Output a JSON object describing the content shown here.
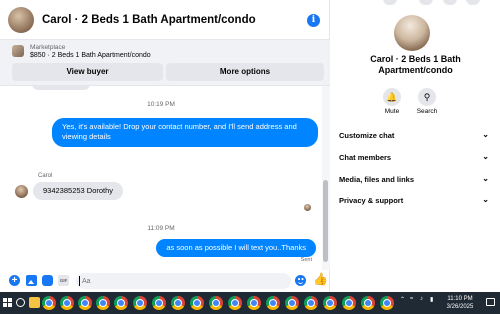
{
  "header": {
    "title": "Carol · 2 Beds 1 Bath Apartment/condo"
  },
  "marketplace": {
    "label": "Marketplace",
    "listing": "$850 · 2 Beds 1 Bath Apartment/condo",
    "view_buyer": "View buyer",
    "more_options": "More options"
  },
  "messages": {
    "time_1": "10:19 PM",
    "reply_1_line1": "Yes, it's available! Drop your contact number, and I'll send address and",
    "reply_1_line2": "viewing details",
    "sender": "Carol",
    "incoming_1": "9342385253 Dorothy",
    "time_2": "11:09 PM",
    "reply_2": "as soon as possible I will text you..Thanks",
    "status": "Sent"
  },
  "composer": {
    "placeholder": "Aa"
  },
  "details": {
    "title_line1": "Carol · 2 Beds 1 Bath",
    "title_line2": "Apartment/condo",
    "mute": "Mute",
    "search": "Search",
    "sections": [
      "Customize chat",
      "Chat members",
      "Media, files and links",
      "Privacy & support"
    ]
  },
  "taskbar": {
    "time": "11:10 PM",
    "date": "3/26/2025"
  },
  "colors": {
    "accent": "#0084ff",
    "brand": "#1877f2",
    "taskbar": "#1f2a35"
  }
}
